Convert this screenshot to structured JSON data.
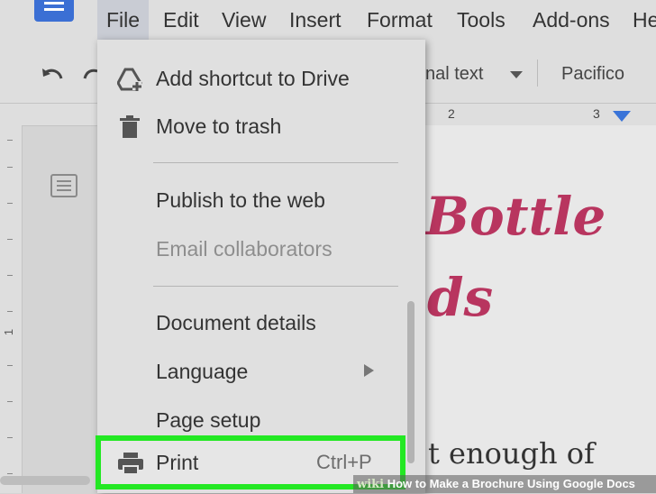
{
  "menubar": {
    "items": [
      "File",
      "Edit",
      "View",
      "Insert",
      "Format",
      "Tools",
      "Add-ons",
      "He"
    ]
  },
  "toolbar": {
    "style_dropdown": "nal text",
    "font_dropdown": "Pacifico"
  },
  "ruler": {
    "labels": [
      "2",
      "3"
    ],
    "vertical_label": "1"
  },
  "document": {
    "headline_line1": "Bottle",
    "headline_line2": "ds",
    "body_fragment": "t enough of"
  },
  "file_menu": {
    "add_shortcut": "Add shortcut to Drive",
    "move_to_trash": "Move to trash",
    "publish_web": "Publish to the web",
    "email_collaborators": "Email collaborators",
    "document_details": "Document details",
    "language": "Language",
    "page_setup": "Page setup",
    "print": "Print",
    "print_shortcut": "Ctrl+P"
  },
  "watermark": {
    "brand": "wiki",
    "title": "How to Make a Brochure Using Google Docs"
  },
  "colors": {
    "highlight": "#23e823",
    "accent": "#b8355f",
    "docs_blue": "#3b6fd4"
  },
  "icons": [
    "docs-logo-icon",
    "undo-icon",
    "redo-icon",
    "dropdown-arrow-icon",
    "drive-add-icon",
    "trash-icon",
    "submenu-arrow-icon",
    "printer-icon",
    "outline-icon",
    "indent-marker-icon"
  ]
}
